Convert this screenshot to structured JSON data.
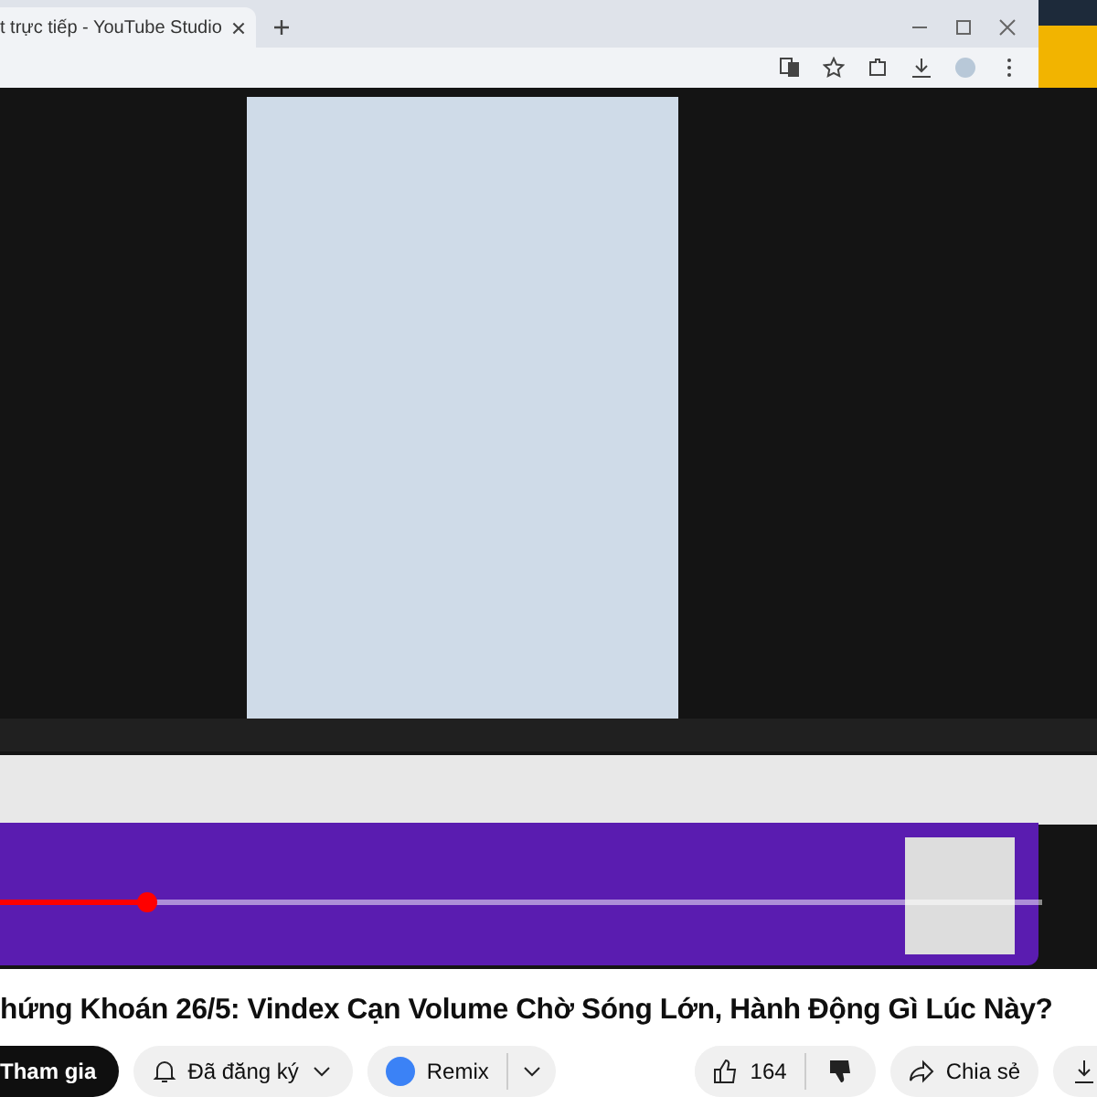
{
  "browser": {
    "tab": {
      "title": "t trực tiếp - YouTube Studio",
      "selected": true
    }
  },
  "player": {
    "progress": {
      "level": 0.14
    }
  },
  "video": {
    "title": "hứng Khoán 26/5: Vindex Cạn Volume Chờ Sóng Lớn, Hành Động Gì Lúc Này?"
  },
  "actions": {
    "join": "Tham gia",
    "subscribe": "Đã đăng ký",
    "remix": "Remix",
    "likes": "164",
    "share": "Chia sẻ"
  }
}
